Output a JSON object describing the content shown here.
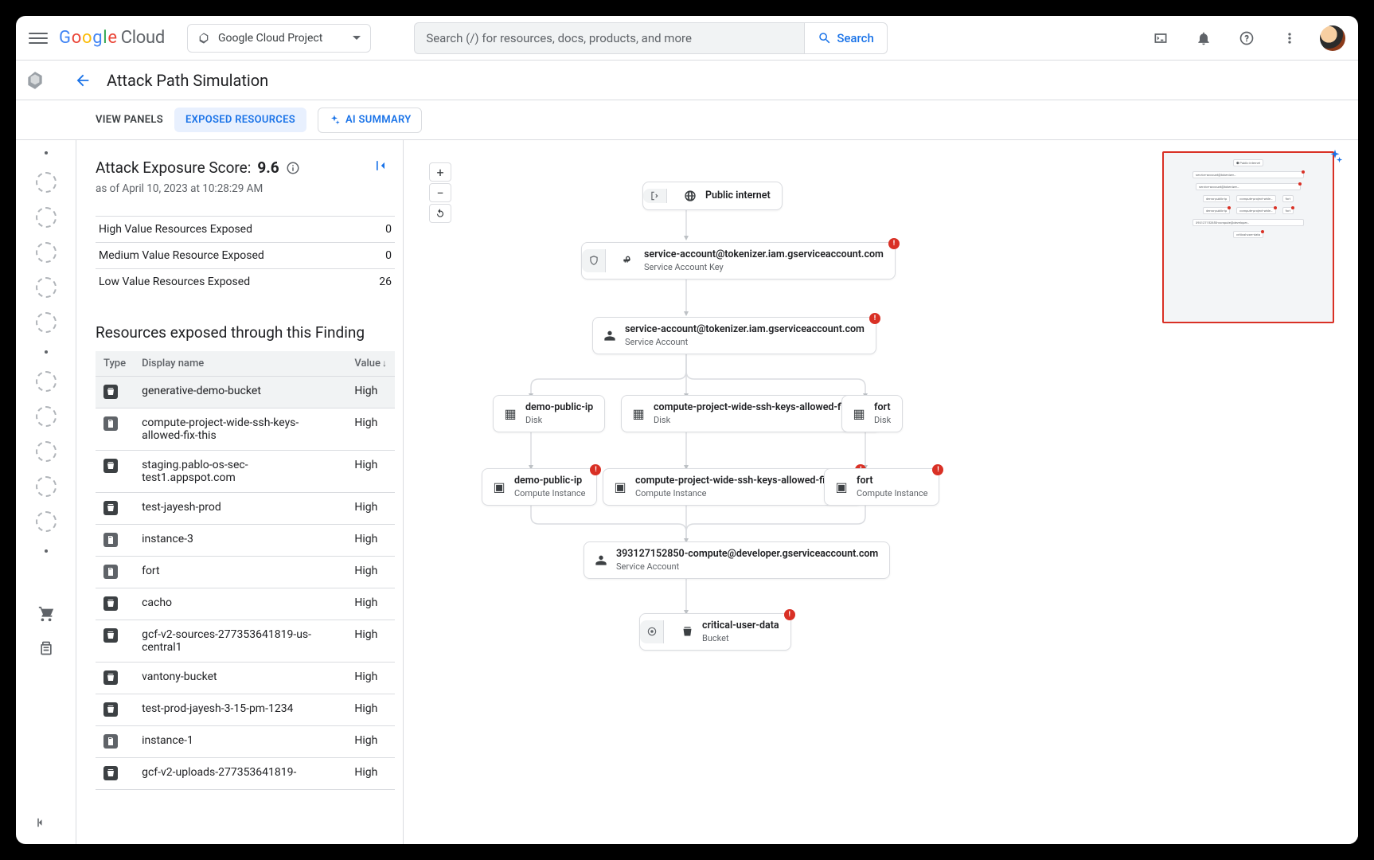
{
  "header": {
    "product": "Cloud",
    "project_label": "Google Cloud Project",
    "search_placeholder": "Search (/) for resources, docs, products, and more",
    "search_button": "Search"
  },
  "page": {
    "title": "Attack Path Simulation",
    "tabs": {
      "view_panels": "VIEW PANELS",
      "exposed_resources": "EXPOSED RESOURCES",
      "ai_summary": "AI SUMMARY"
    }
  },
  "score": {
    "label": "Attack Exposure Score:",
    "value": "9.6",
    "as_of": "as of April 10, 2023 at 10:28:29 AM"
  },
  "metrics": [
    {
      "label": "High Value Resources Exposed",
      "value": "0"
    },
    {
      "label": "Medium Value Resource Exposed",
      "value": "0"
    },
    {
      "label": "Low Value Resources Exposed",
      "value": "26"
    }
  ],
  "resources": {
    "title": "Resources exposed through this Finding",
    "columns": {
      "type": "Type",
      "name": "Display name",
      "value": "Value"
    },
    "rows": [
      {
        "type": "bucket",
        "name": "generative-demo-bucket",
        "value": "High",
        "selected": true
      },
      {
        "type": "doc",
        "name": "compute-project-wide-ssh-keys-allowed-fix-this",
        "value": "High"
      },
      {
        "type": "bucket",
        "name": "staging.pablo-os-sec-test1.appspot.com",
        "value": "High"
      },
      {
        "type": "bucket",
        "name": "test-jayesh-prod",
        "value": "High"
      },
      {
        "type": "doc",
        "name": "instance-3",
        "value": "High"
      },
      {
        "type": "doc",
        "name": "fort",
        "value": "High"
      },
      {
        "type": "bucket",
        "name": "cacho",
        "value": "High"
      },
      {
        "type": "bucket",
        "name": "gcf-v2-sources-277353641819-us-central1",
        "value": "High"
      },
      {
        "type": "bucket",
        "name": "vantony-bucket",
        "value": "High"
      },
      {
        "type": "bucket",
        "name": "test-prod-jayesh-3-15-pm-1234",
        "value": "High"
      },
      {
        "type": "doc",
        "name": "instance-1",
        "value": "High"
      },
      {
        "type": "bucket",
        "name": "gcf-v2-uploads-277353641819-",
        "value": "High"
      }
    ]
  },
  "graph": {
    "n0": {
      "title": "Public internet"
    },
    "n1": {
      "title": "service-account@tokenizer.iam.gserviceaccount.com",
      "sub": "Service Account Key"
    },
    "n2": {
      "title": "service-account@tokenizer.iam.gserviceaccount.com",
      "sub": "Service Account"
    },
    "n3": {
      "title": "demo-public-ip",
      "sub": "Disk"
    },
    "n4": {
      "title": "compute-project-wide-ssh-keys-allowed-fix-this",
      "sub": "Disk"
    },
    "n5": {
      "title": "fort",
      "sub": "Disk"
    },
    "n6": {
      "title": "demo-public-ip",
      "sub": "Compute Instance"
    },
    "n7": {
      "title": "compute-project-wide-ssh-keys-allowed-fix-this",
      "sub": "Compute Instance"
    },
    "n8": {
      "title": "fort",
      "sub": "Compute Instance"
    },
    "n9": {
      "title": "393127152850-compute@developer.gserviceaccount.com",
      "sub": "Service Account"
    },
    "n10": {
      "title": "critical-user-data",
      "sub": "Bucket"
    }
  }
}
